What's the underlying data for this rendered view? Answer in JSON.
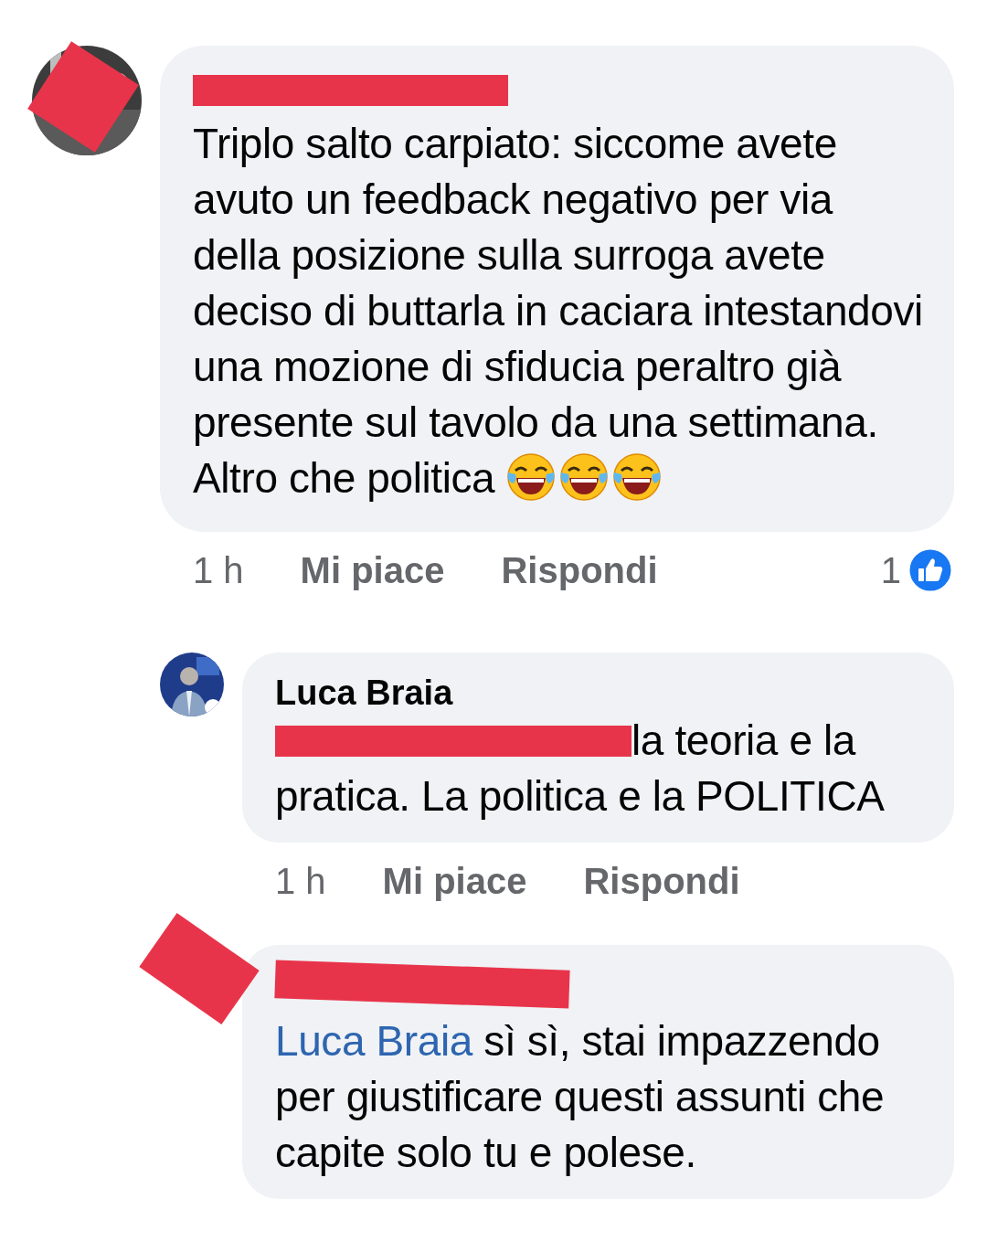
{
  "comments": [
    {
      "avatar_redacted": true,
      "name_redacted": true,
      "body": [
        {
          "kind": "text",
          "text": "Triplo salto carpiato: siccome avete avuto un feedback negativo per via della posizione sulla surroga avete deciso di buttarla in caciara intestandovi una mozione di sfiducia peraltro già presente sul tavolo da una settimana.\nAltro che politica "
        },
        {
          "kind": "emoji"
        },
        {
          "kind": "emoji"
        },
        {
          "kind": "emoji"
        }
      ],
      "time": "1 h",
      "like_label": "Mi piace",
      "reply_label": "Rispondi",
      "like_count": "1",
      "replies": [
        {
          "avatar_redacted": false,
          "name_redacted": false,
          "name": "Luca Braia",
          "body": [
            {
              "kind": "redacted"
            },
            {
              "kind": "text",
              "text": "la teoria e la pratica. La politica e la POLITICA"
            }
          ],
          "time": "1 h",
          "like_label": "Mi piace",
          "reply_label": "Rispondi"
        },
        {
          "avatar_redacted": true,
          "name_redacted": true,
          "body": [
            {
              "kind": "mention",
              "text": "Luca Braia"
            },
            {
              "kind": "text",
              "text": " sì sì, stai impazzendo per giustificare questi assunti che capite solo tu e polese."
            }
          ]
        }
      ]
    }
  ]
}
